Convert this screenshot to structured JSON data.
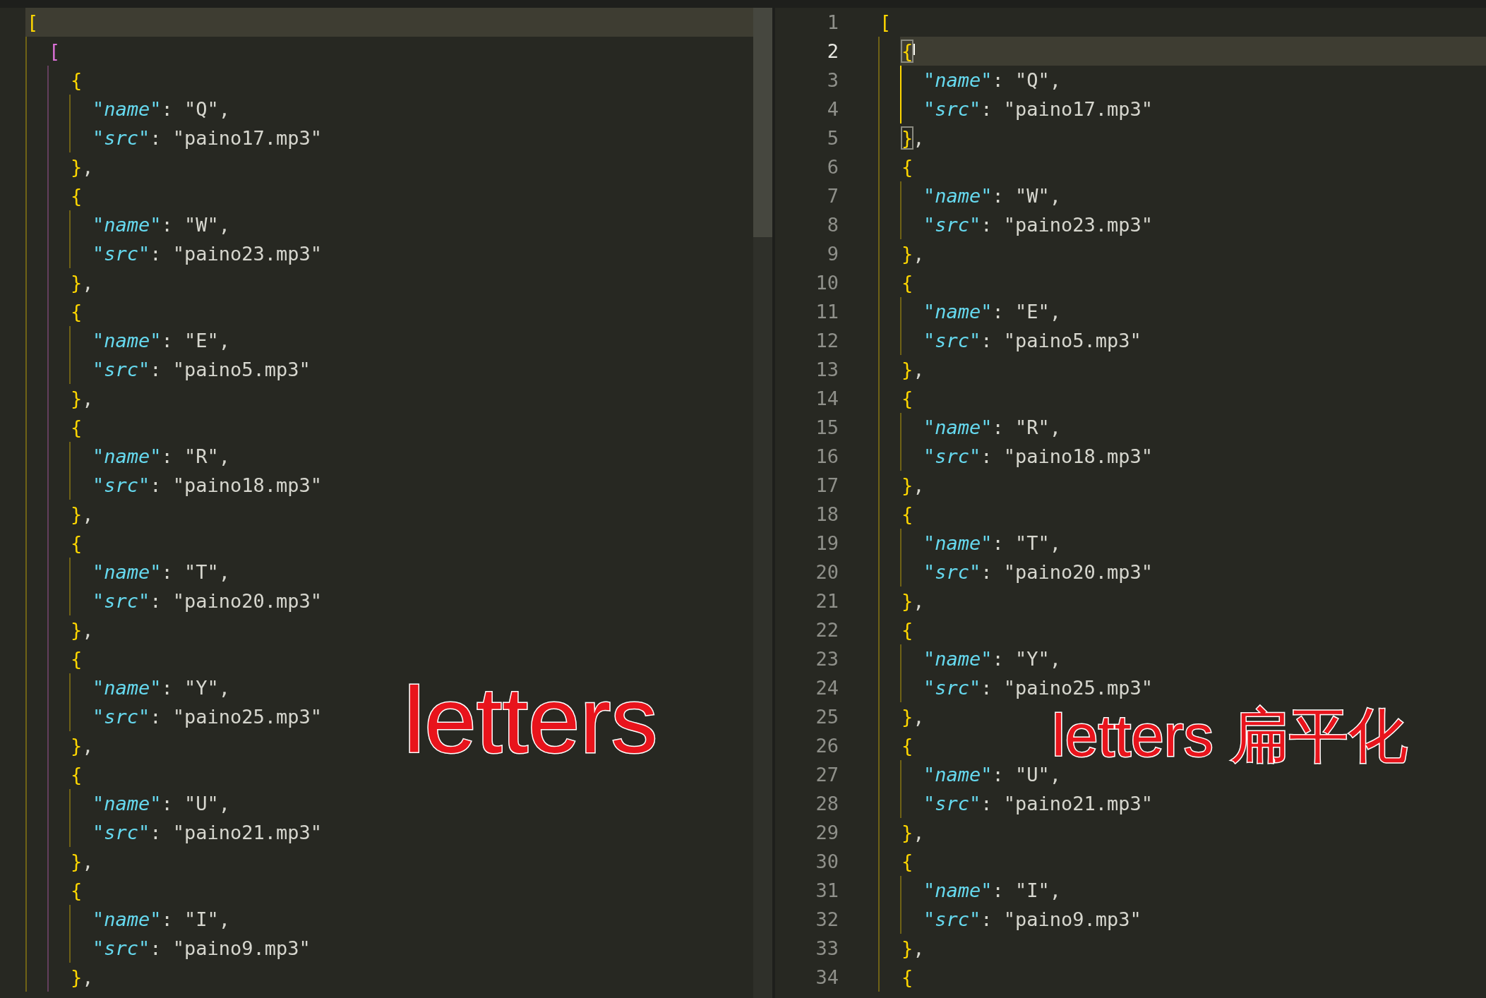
{
  "editors": [
    {
      "scrollbar": true,
      "annotation": "letters",
      "code": [
        {
          "open": "[",
          "color": "#ffd700",
          "current": true,
          "matched": false,
          "children": [
            {
              "open": "[",
              "color": "#da70d6",
              "current": false,
              "matched": false,
              "children": [
                {
                  "open": "{",
                  "close": "},",
                  "color": "#ffd700",
                  "current": false,
                  "matched": false,
                  "children": [
                    {
                      "key": "\"name\"",
                      "value": ": \"Q\","
                    },
                    {
                      "key": "\"src\"",
                      "value": ": \"paino17.mp3\""
                    }
                  ]
                },
                {
                  "open": "{",
                  "close": "},",
                  "color": "#ffd700",
                  "current": false,
                  "matched": false,
                  "children": [
                    {
                      "key": "\"name\"",
                      "value": ": \"W\","
                    },
                    {
                      "key": "\"src\"",
                      "value": ": \"paino23.mp3\""
                    }
                  ]
                },
                {
                  "open": "{",
                  "close": "},",
                  "color": "#ffd700",
                  "current": false,
                  "matched": false,
                  "children": [
                    {
                      "key": "\"name\"",
                      "value": ": \"E\","
                    },
                    {
                      "key": "\"src\"",
                      "value": ": \"paino5.mp3\""
                    }
                  ]
                },
                {
                  "open": "{",
                  "close": "},",
                  "color": "#ffd700",
                  "current": false,
                  "matched": false,
                  "children": [
                    {
                      "key": "\"name\"",
                      "value": ": \"R\","
                    },
                    {
                      "key": "\"src\"",
                      "value": ": \"paino18.mp3\""
                    }
                  ]
                },
                {
                  "open": "{",
                  "close": "},",
                  "color": "#ffd700",
                  "current": false,
                  "matched": false,
                  "children": [
                    {
                      "key": "\"name\"",
                      "value": ": \"T\","
                    },
                    {
                      "key": "\"src\"",
                      "value": ": \"paino20.mp3\""
                    }
                  ]
                },
                {
                  "open": "{",
                  "close": "},",
                  "color": "#ffd700",
                  "current": false,
                  "matched": false,
                  "children": [
                    {
                      "key": "\"name\"",
                      "value": ": \"Y\","
                    },
                    {
                      "key": "\"src\"",
                      "value": ": \"paino25.mp3\""
                    }
                  ]
                },
                {
                  "open": "{",
                  "close": "},",
                  "color": "#ffd700",
                  "current": false,
                  "matched": false,
                  "children": [
                    {
                      "key": "\"name\"",
                      "value": ": \"U\","
                    },
                    {
                      "key": "\"src\"",
                      "value": ": \"paino21.mp3\""
                    }
                  ]
                },
                {
                  "open": "{",
                  "close": "},",
                  "color": "#ffd700",
                  "current": false,
                  "matched": false,
                  "children": [
                    {
                      "key": "\"name\"",
                      "value": ": \"I\","
                    },
                    {
                      "key": "\"src\"",
                      "value": ": \"paino9.mp3\""
                    }
                  ]
                }
              ]
            }
          ]
        }
      ]
    },
    {
      "annotation": "letters 扁平化",
      "line_numbers": [
        "1",
        "2",
        "3",
        "4",
        "5",
        "6",
        "7",
        "8",
        "9",
        "10",
        "11",
        "12",
        "13",
        "14",
        "15",
        "16",
        "17",
        "18",
        "19",
        "20",
        "21",
        "22",
        "23",
        "24",
        "25",
        "26",
        "27",
        "28",
        "29",
        "30",
        "31",
        "32",
        "33",
        "34"
      ],
      "code": [
        {
          "open": "[",
          "color": "#ffd700",
          "current": false,
          "matched": false,
          "children": [
            {
              "open": "{",
              "close": "},",
              "color": "#ffd700",
              "current": true,
              "matched": true,
              "children": [
                {
                  "key": "\"name\"",
                  "value": ": \"Q\","
                },
                {
                  "key": "\"src\"",
                  "value": ": \"paino17.mp3\""
                }
              ]
            },
            {
              "open": "{",
              "close": "},",
              "color": "#ffd700",
              "current": false,
              "matched": false,
              "children": [
                {
                  "key": "\"name\"",
                  "value": ": \"W\","
                },
                {
                  "key": "\"src\"",
                  "value": ": \"paino23.mp3\""
                }
              ]
            },
            {
              "open": "{",
              "close": "},",
              "color": "#ffd700",
              "current": false,
              "matched": false,
              "children": [
                {
                  "key": "\"name\"",
                  "value": ": \"E\","
                },
                {
                  "key": "\"src\"",
                  "value": ": \"paino5.mp3\""
                }
              ]
            },
            {
              "open": "{",
              "close": "},",
              "color": "#ffd700",
              "current": false,
              "matched": false,
              "children": [
                {
                  "key": "\"name\"",
                  "value": ": \"R\","
                },
                {
                  "key": "\"src\"",
                  "value": ": \"paino18.mp3\""
                }
              ]
            },
            {
              "open": "{",
              "close": "},",
              "color": "#ffd700",
              "current": false,
              "matched": false,
              "children": [
                {
                  "key": "\"name\"",
                  "value": ": \"T\","
                },
                {
                  "key": "\"src\"",
                  "value": ": \"paino20.mp3\""
                }
              ]
            },
            {
              "open": "{",
              "close": "},",
              "color": "#ffd700",
              "current": false,
              "matched": false,
              "children": [
                {
                  "key": "\"name\"",
                  "value": ": \"Y\","
                },
                {
                  "key": "\"src\"",
                  "value": ": \"paino25.mp3\""
                }
              ]
            },
            {
              "open": "{",
              "close": "},",
              "color": "#ffd700",
              "current": false,
              "matched": false,
              "children": [
                {
                  "key": "\"name\"",
                  "value": ": \"U\","
                },
                {
                  "key": "\"src\"",
                  "value": ": \"paino21.mp3\""
                }
              ]
            },
            {
              "open": "{",
              "close": "},",
              "color": "#ffd700",
              "current": false,
              "matched": false,
              "children": [
                {
                  "key": "\"name\"",
                  "value": ": \"I\","
                },
                {
                  "key": "\"src\"",
                  "value": ": \"paino9.mp3\""
                }
              ]
            },
            {
              "open": "{",
              "color": "#ffd700",
              "current": false,
              "matched": false
            }
          ]
        }
      ]
    }
  ]
}
